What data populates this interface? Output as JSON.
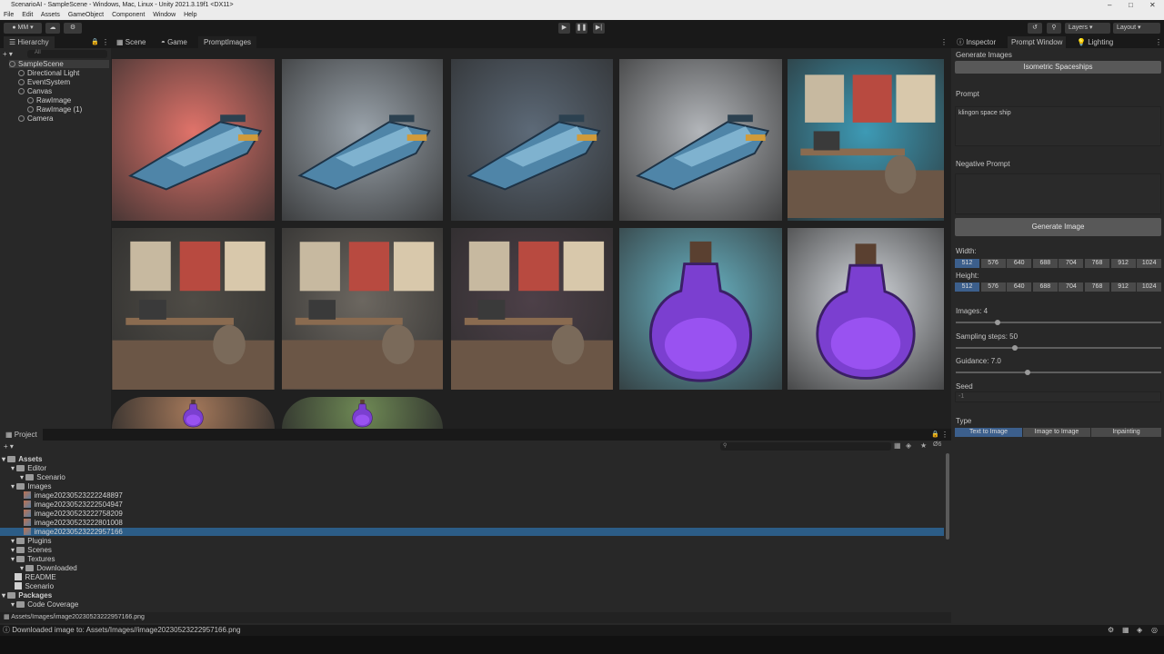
{
  "window": {
    "title": "ScenarioAI - SampleScene - Windows, Mac, Linux - Unity 2021.3.19f1 <DX11>"
  },
  "menu": [
    "File",
    "Edit",
    "Assets",
    "GameObject",
    "Component",
    "Window",
    "Help"
  ],
  "toolbar": {
    "account": "MM",
    "layers": "Layers",
    "layout": "Layout"
  },
  "hierarchy": {
    "tab": "Hierarchy",
    "search_placeholder": "All",
    "items": [
      {
        "label": "SampleScene",
        "depth": 0
      },
      {
        "label": "Directional Light",
        "depth": 1
      },
      {
        "label": "EventSystem",
        "depth": 1
      },
      {
        "label": "Canvas",
        "depth": 1
      },
      {
        "label": "RawImage",
        "depth": 2
      },
      {
        "label": "RawImage (1)",
        "depth": 2
      },
      {
        "label": "Camera",
        "depth": 1
      }
    ]
  },
  "view_tabs": [
    "Scene",
    "Game",
    "PromptImages"
  ],
  "gallery": {
    "images": [
      {
        "subject": "spaceship",
        "bg": "#e0736a"
      },
      {
        "subject": "spaceship",
        "bg": "#9aa3ab"
      },
      {
        "subject": "spaceship",
        "bg": "#5d6a78"
      },
      {
        "subject": "spaceship",
        "bg": "#b3b6ba"
      },
      {
        "subject": "retro office",
        "bg": "#3d9ab5"
      },
      {
        "subject": "retro office",
        "bg": "#4f4c46"
      },
      {
        "subject": "retro office",
        "bg": "#6c6760"
      },
      {
        "subject": "retro office",
        "bg": "#4d4048"
      },
      {
        "subject": "potion",
        "bg": "#6bb8c9"
      },
      {
        "subject": "potion",
        "bg": "#d7dbe0"
      },
      {
        "subject": "potion",
        "bg": "#a4785a"
      },
      {
        "subject": "potion",
        "bg": "#6f8a55"
      }
    ]
  },
  "inspector": {
    "tabs": [
      "Inspector",
      "Prompt Window",
      "Lighting"
    ],
    "header": "Generate Images",
    "preset_button": "Isometric Spaceships",
    "prompt_label": "Prompt",
    "prompt_value": "klingon space ship",
    "negative_label": "Negative Prompt",
    "negative_value": "",
    "generate_button": "Generate Image",
    "width_label": "Width:",
    "height_label": "Height:",
    "sizes": [
      "512",
      "576",
      "640",
      "688",
      "704",
      "768",
      "912",
      "1024"
    ],
    "images_label": "Images: 4",
    "images_value": 4,
    "steps_label": "Sampling steps: 50",
    "steps_value": 50,
    "guidance_label": "Guidance: 7.0",
    "guidance_value": 7.0,
    "seed_label": "Seed",
    "seed_value": "-1",
    "type_label": "Type",
    "types": [
      "Text to Image",
      "Image to Image",
      "Inpainting"
    ]
  },
  "project": {
    "tab": "Project",
    "items": [
      {
        "label": "Assets",
        "depth": 0,
        "kind": "folder",
        "bold": true
      },
      {
        "label": "Editor",
        "depth": 1,
        "kind": "folder"
      },
      {
        "label": "Scenario",
        "depth": 2,
        "kind": "folder"
      },
      {
        "label": "Images",
        "depth": 1,
        "kind": "folder"
      },
      {
        "label": "image20230523222248897",
        "depth": 2,
        "kind": "image"
      },
      {
        "label": "image20230523222504947",
        "depth": 2,
        "kind": "image"
      },
      {
        "label": "image20230523222758209",
        "depth": 2,
        "kind": "image"
      },
      {
        "label": "image20230523222801008",
        "depth": 2,
        "kind": "image"
      },
      {
        "label": "image20230523222957166",
        "depth": 2,
        "kind": "image",
        "selected": true
      },
      {
        "label": "Plugins",
        "depth": 1,
        "kind": "folder"
      },
      {
        "label": "Scenes",
        "depth": 1,
        "kind": "folder"
      },
      {
        "label": "Textures",
        "depth": 1,
        "kind": "folder"
      },
      {
        "label": "Downloaded",
        "depth": 2,
        "kind": "folder"
      },
      {
        "label": "README",
        "depth": 1,
        "kind": "file"
      },
      {
        "label": "Scenario",
        "depth": 1,
        "kind": "file"
      },
      {
        "label": "Packages",
        "depth": 0,
        "kind": "folder",
        "bold": true
      },
      {
        "label": "Code Coverage",
        "depth": 1,
        "kind": "folder"
      }
    ],
    "path": "Assets/Images/image20230523222957166.png",
    "hidden_count": "6"
  },
  "status": {
    "message": "Downloaded image to: Assets/Images//image20230523222957166.png"
  }
}
